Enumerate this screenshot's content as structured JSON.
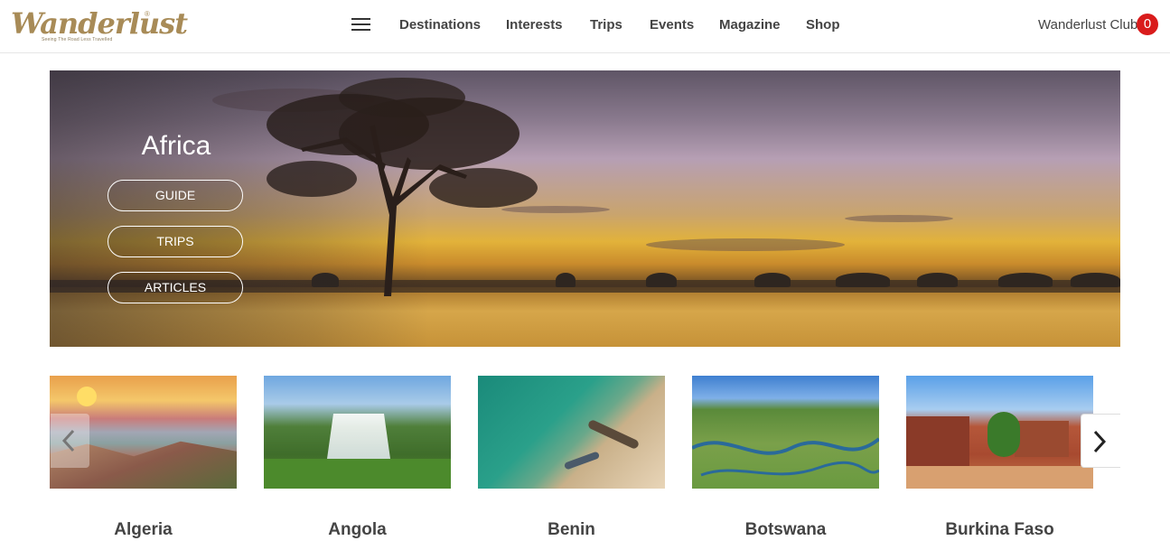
{
  "header": {
    "logo_text": "Wanderlust",
    "logo_tagline": "Seeing The Road Less Travelled",
    "logo_reg": "®",
    "nav": [
      "Destinations",
      "Interests",
      "Trips",
      "Events",
      "Magazine",
      "Shop"
    ],
    "club_label": "Wanderlust Club",
    "club_count": "0"
  },
  "hero": {
    "title": "Africa",
    "buttons": [
      "GUIDE",
      "TRIPS",
      "ARTICLES"
    ]
  },
  "countries": [
    "Algeria",
    "Angola",
    "Benin",
    "Botswana",
    "Burkina Faso"
  ],
  "icons": {
    "menu": "hamburger-menu-icon",
    "prev": "chevron-left-icon",
    "next": "chevron-right-icon"
  },
  "colors": {
    "brand": "#a88b57",
    "badge": "#d91c1c"
  }
}
